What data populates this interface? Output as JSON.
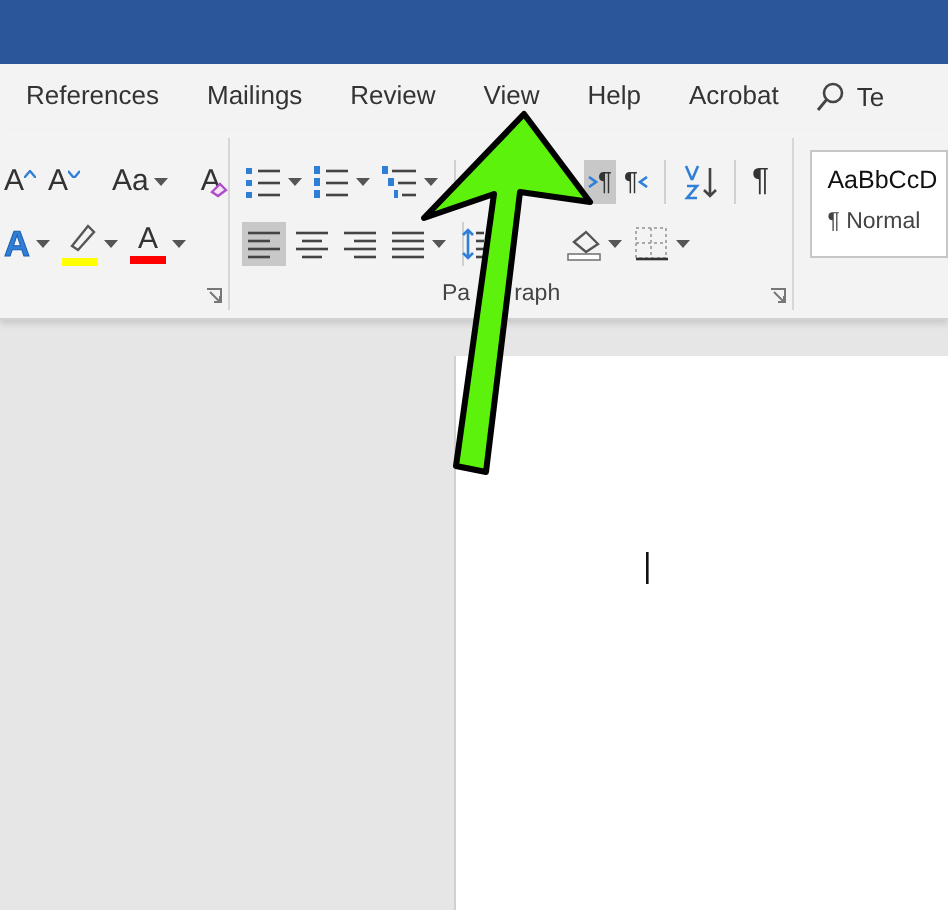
{
  "tabs": [
    {
      "label": "References",
      "selected": false
    },
    {
      "label": "Mailings",
      "selected": false
    },
    {
      "label": "Review",
      "selected": false
    },
    {
      "label": "View",
      "selected": false
    },
    {
      "label": "Help",
      "selected": false
    },
    {
      "label": "Acrobat",
      "selected": false
    }
  ],
  "search": {
    "placeholder": "Te"
  },
  "font_group": {
    "rows": [
      [
        {
          "kind": "grow-font",
          "glyph": "A",
          "selected": false,
          "dropdown": false
        },
        {
          "kind": "shrink-font",
          "glyph": "A",
          "selected": false,
          "dropdown": false
        },
        {
          "kind": "sep"
        },
        {
          "kind": "change-case",
          "glyph": "Aa",
          "selected": false,
          "dropdown": true
        },
        {
          "kind": "sep"
        },
        {
          "kind": "clear-format",
          "glyph": "A",
          "selected": false,
          "dropdown": false
        }
      ],
      [
        {
          "kind": "text-effects",
          "glyph": "A",
          "selected": false,
          "dropdown": true
        },
        {
          "kind": "highlight",
          "color": "#ffff00",
          "selected": false,
          "dropdown": true
        },
        {
          "kind": "font-color",
          "glyph": "A",
          "color": "#ff0000",
          "selected": false,
          "dropdown": true
        }
      ]
    ]
  },
  "paragraph_group": {
    "label_parts": [
      "Pa",
      "raph"
    ],
    "rows": [
      [
        {
          "kind": "bullets",
          "selected": false,
          "dropdown": true
        },
        {
          "kind": "numbering",
          "selected": false,
          "dropdown": true
        },
        {
          "kind": "multilevel",
          "selected": false,
          "dropdown": true
        },
        {
          "kind": "sep"
        },
        {
          "kind": "ltr",
          "glyph": "¶",
          "selected": true,
          "dropdown": false
        },
        {
          "kind": "rtl",
          "glyph": "¶",
          "selected": false,
          "dropdown": false
        },
        {
          "kind": "sep"
        },
        {
          "kind": "sort",
          "selected": false,
          "dropdown": false
        },
        {
          "kind": "sep"
        },
        {
          "kind": "show-marks",
          "glyph": "¶",
          "selected": false,
          "dropdown": false
        }
      ],
      [
        {
          "kind": "align-left",
          "selected": true,
          "dropdown": false
        },
        {
          "kind": "align-center",
          "selected": false,
          "dropdown": false
        },
        {
          "kind": "align-right",
          "selected": false,
          "dropdown": false
        },
        {
          "kind": "justify",
          "selected": false,
          "dropdown": true
        },
        {
          "kind": "sep"
        },
        {
          "kind": "line-spacing",
          "selected": false,
          "dropdown": false
        },
        {
          "kind": "sep"
        },
        {
          "kind": "shading",
          "selected": false,
          "dropdown": true
        },
        {
          "kind": "borders",
          "selected": false,
          "dropdown": true
        }
      ]
    ]
  },
  "styles": {
    "preview": "AaBbCcD",
    "name": "¶ Normal"
  }
}
